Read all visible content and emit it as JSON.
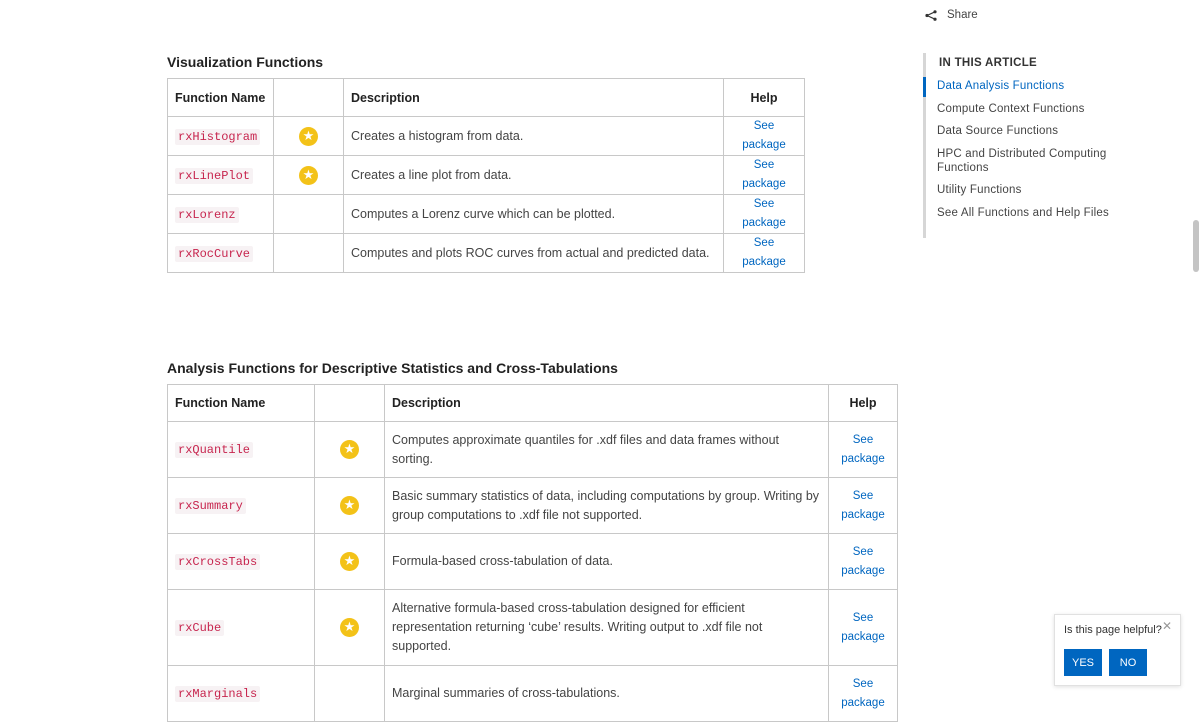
{
  "share": {
    "label": "Share"
  },
  "viz_section": {
    "title": "Visualization Functions",
    "headers": {
      "name": "Function Name",
      "icon": "",
      "description": "Description",
      "help": "Help"
    },
    "rows": [
      {
        "name": "rxHistogram",
        "starred": true,
        "description": "Creates a histogram from data.",
        "help": "See package"
      },
      {
        "name": "rxLinePlot",
        "starred": true,
        "description": "Creates a line plot from data.",
        "help": "See package"
      },
      {
        "name": "rxLorenz",
        "starred": false,
        "description": "Computes a Lorenz curve which can be plotted.",
        "help": "See package"
      },
      {
        "name": "rxRocCurve",
        "starred": false,
        "description": "Computes and plots ROC curves from actual and predicted data.",
        "help": "See package"
      }
    ]
  },
  "analysis_section": {
    "title": "Analysis Functions for Descriptive Statistics and Cross-Tabulations",
    "headers": {
      "name": "Function Name",
      "icon": "",
      "description": "Description",
      "help": "Help"
    },
    "rows": [
      {
        "name": "rxQuantile",
        "starred": true,
        "description": "Computes approximate quantiles for .xdf files and data frames without sorting.",
        "help": "See package"
      },
      {
        "name": "rxSummary",
        "starred": true,
        "description": "Basic summary statistics of data, including computations by group. Writing by group computations to .xdf file not supported.",
        "help": "See package"
      },
      {
        "name": "rxCrossTabs",
        "starred": true,
        "description": "Formula-based cross-tabulation of data.",
        "help": "See package"
      },
      {
        "name": "rxCube",
        "starred": true,
        "description": "Alternative formula-based cross-tabulation designed for efficient representation returning ‘cube’ results. Writing output to .xdf file not supported.",
        "help": "See package"
      },
      {
        "name": "rxMarginals",
        "starred": false,
        "description": "Marginal summaries of cross-tabulations.",
        "help": "See package"
      }
    ]
  },
  "toc": {
    "title": "IN THIS ARTICLE",
    "items": [
      {
        "label": "Data Analysis Functions",
        "active": true
      },
      {
        "label": "Compute Context Functions",
        "active": false
      },
      {
        "label": "Data Source Functions",
        "active": false
      },
      {
        "label": "HPC and Distributed Computing Functions",
        "active": false
      },
      {
        "label": "Utility Functions",
        "active": false
      },
      {
        "label": "See All Functions and Help Files",
        "active": false
      }
    ]
  },
  "feedback": {
    "question": "Is this page helpful?",
    "yes": "YES",
    "no": "NO",
    "close": "✕"
  },
  "icons": {
    "star": "star-icon",
    "share": "share-icon",
    "close": "close-icon"
  },
  "colors": {
    "accent": "#0066c0",
    "star": "#f3c218",
    "code": "#c7254e",
    "border": "#c8c8c8"
  }
}
